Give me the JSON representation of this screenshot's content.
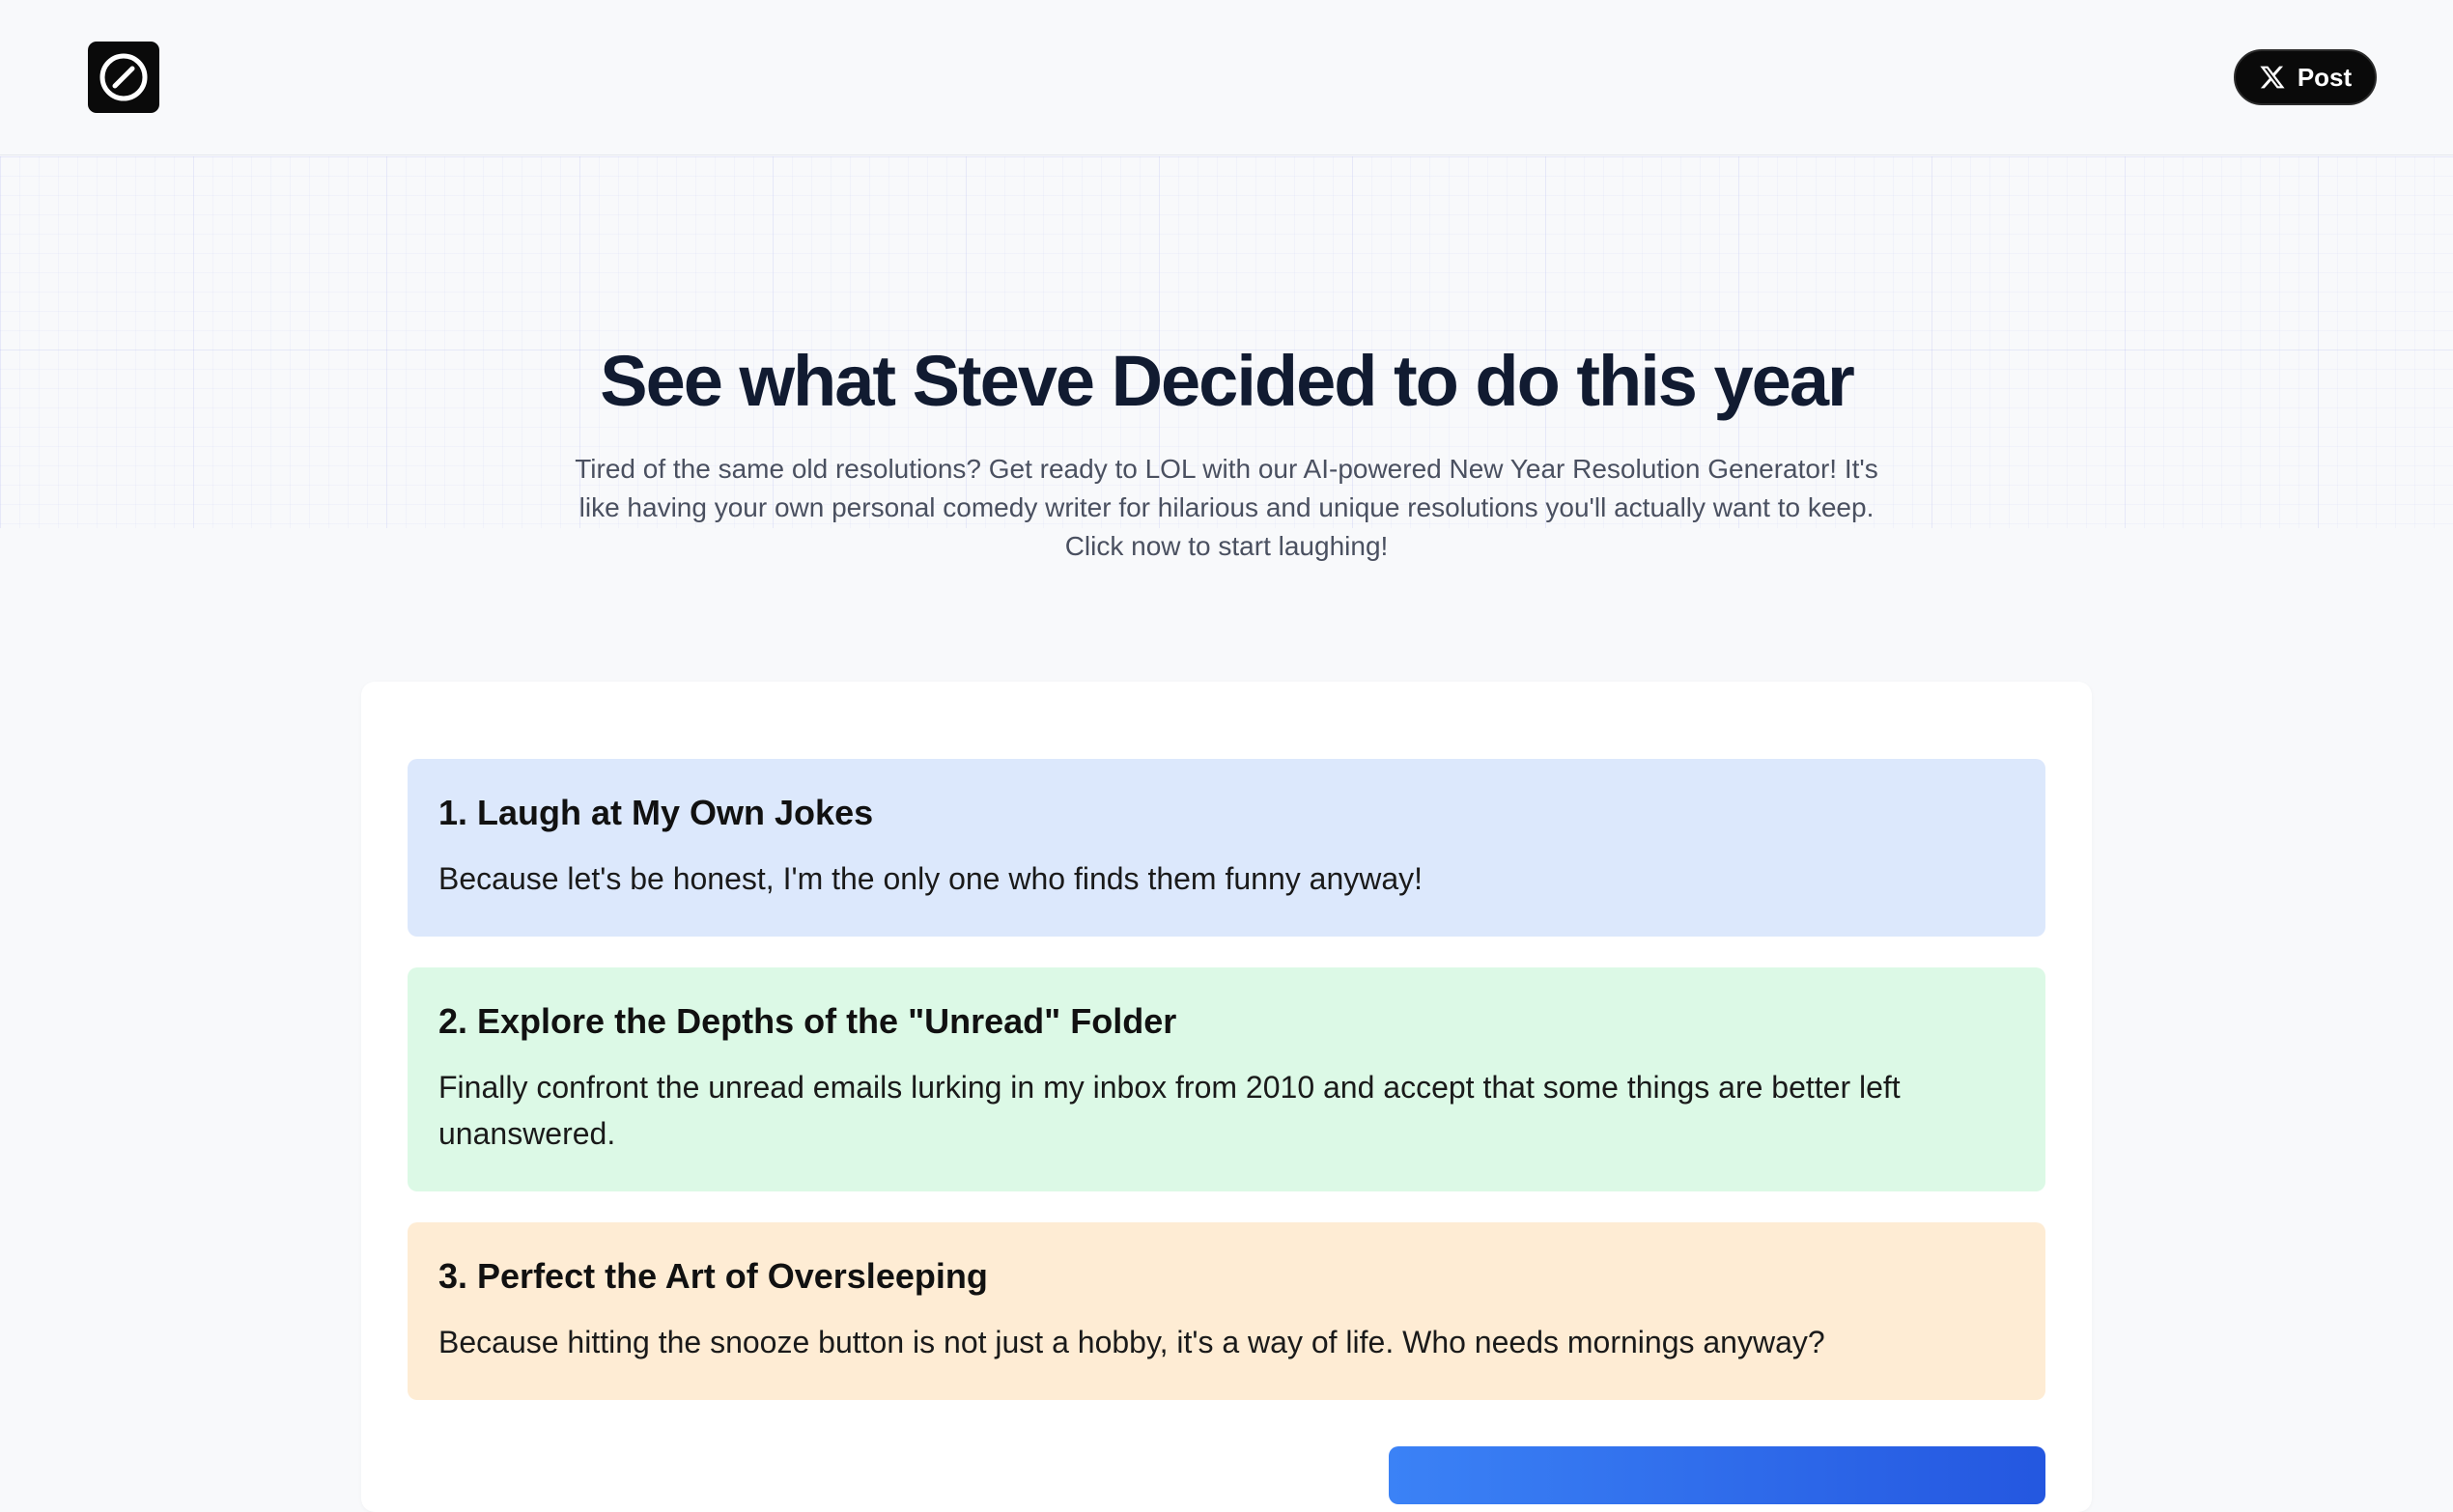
{
  "header": {
    "logo_icon": "slash-circle-icon",
    "post_button": {
      "icon": "x-logo-icon",
      "label": "Post"
    }
  },
  "hero": {
    "title": "See what Steve Decided to do this year",
    "subtitle": "Tired of the same old resolutions? Get ready to LOL with our AI-powered New Year Resolution Generator! It's like having your own personal comedy writer for hilarious and unique resolutions you'll actually want to keep. Click now to start laughing!"
  },
  "resolutions": [
    {
      "title": "1. Laugh at My Own Jokes",
      "description": "Because let's be honest, I'm the only one who finds them funny anyway!",
      "color": "#dce8fc"
    },
    {
      "title": "2. Explore the Depths of the \"Unread\" Folder",
      "description": "Finally confront the unread emails lurking in my inbox from 2010 and accept that some things are better left unanswered.",
      "color": "#dcf9e6"
    },
    {
      "title": "3. Perfect the Art of Oversleeping",
      "description": "Because hitting the snooze button is not just a hobby, it's a way of life. Who needs mornings anyway?",
      "color": "#feecd4"
    }
  ],
  "colors": {
    "background": "#f8f9fb",
    "title": "#111b31",
    "cta_start": "#3b82f6",
    "cta_end": "#2457e0"
  }
}
